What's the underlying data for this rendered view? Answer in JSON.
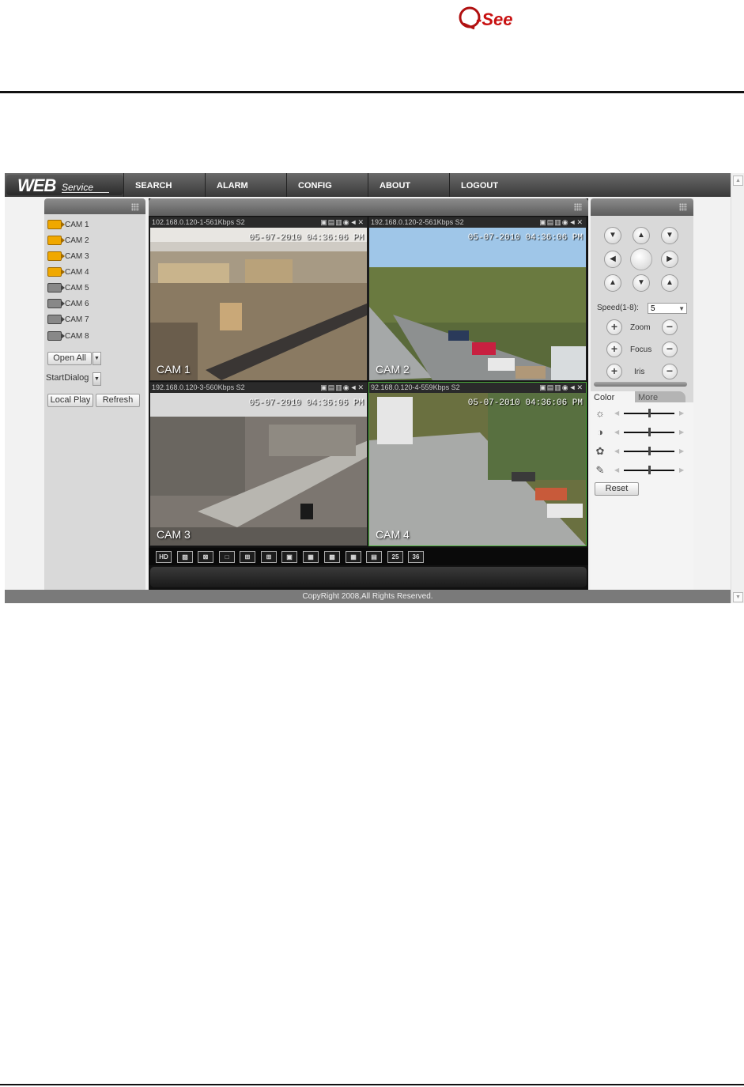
{
  "logo": {
    "text": "Q-See"
  },
  "menu": {
    "brand_main": "WEB",
    "brand_sub": "Service",
    "items": [
      "SEARCH",
      "ALARM",
      "CONFIG",
      "ABOUT",
      "LOGOUT"
    ]
  },
  "cameras": [
    {
      "label": "CAM 1",
      "active": true
    },
    {
      "label": "CAM 2",
      "active": true
    },
    {
      "label": "CAM 3",
      "active": true
    },
    {
      "label": "CAM 4",
      "active": true
    },
    {
      "label": "CAM 5",
      "active": false
    },
    {
      "label": "CAM 6",
      "active": false
    },
    {
      "label": "CAM 7",
      "active": false
    },
    {
      "label": "CAM 8",
      "active": false
    }
  ],
  "left_controls": {
    "open_all": "Open All",
    "start_dialog": "StartDialog",
    "local_play": "Local Play",
    "refresh": "Refresh"
  },
  "videos": [
    {
      "info": "102.168.0.120-1-561Kbps S2",
      "timestamp": "05-07-2010 04:36:06 PM",
      "name": "CAM 1",
      "selected": false
    },
    {
      "info": "192.168.0.120-2-561Kbps S2",
      "timestamp": "05-07-2010 04:36:06 PM",
      "name": "CAM 2",
      "selected": false
    },
    {
      "info": "192.168.0.120-3-560Kbps S2",
      "timestamp": "05-07-2010 04:36:06 PM",
      "name": "CAM 3",
      "selected": false
    },
    {
      "info": "92.168.0.120-4-559Kbps S2",
      "timestamp": "05-07-2010 04:36:06 PM",
      "name": "CAM 4",
      "selected": true
    }
  ],
  "layout_buttons": [
    "HD",
    "",
    "",
    "",
    "",
    "",
    "",
    "",
    "",
    "",
    "",
    "25",
    "36"
  ],
  "ptz": {
    "speed_label": "Speed(1-8):",
    "speed_value": "5",
    "zoom": "Zoom",
    "focus": "Focus",
    "iris": "Iris"
  },
  "color_tabs": {
    "color": "Color",
    "more": "More"
  },
  "color_reset": "Reset",
  "sliders": [
    0.5,
    0.5,
    0.5,
    0.5
  ],
  "copyright": "CopyRight 2008,All Rights Reserved."
}
